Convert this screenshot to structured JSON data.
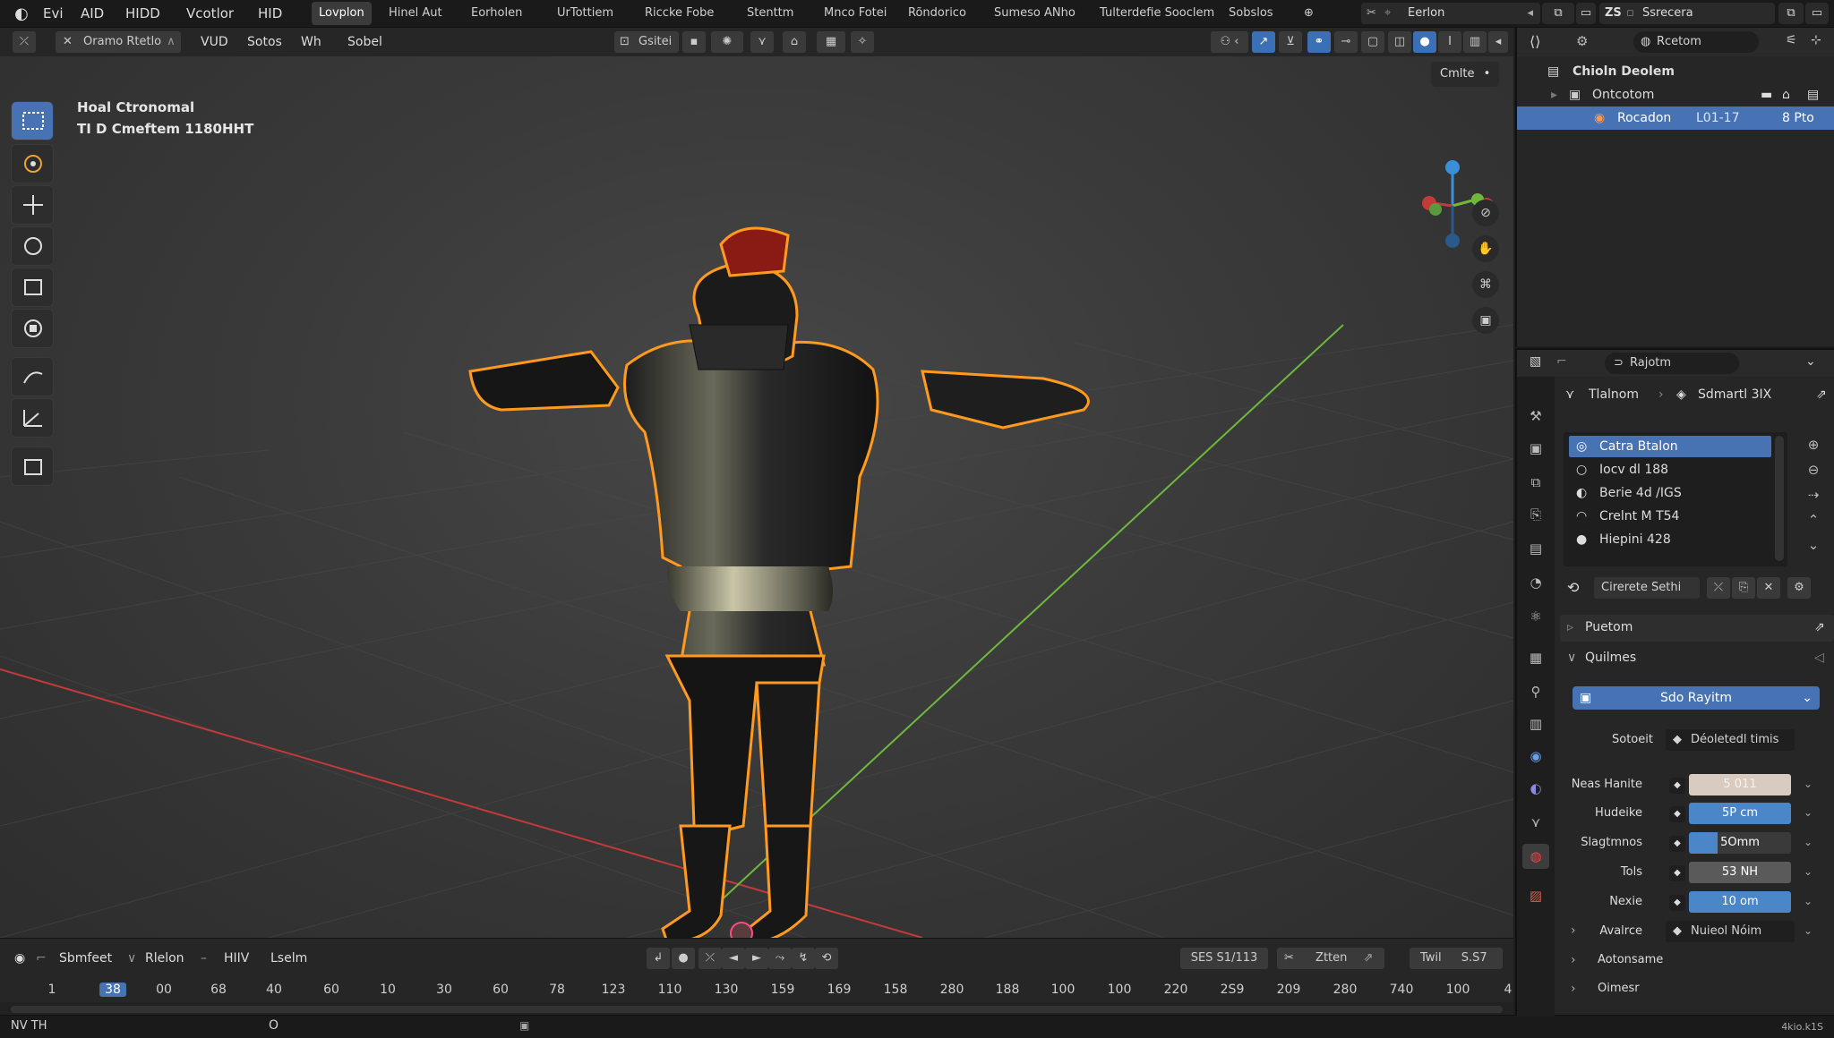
{
  "app_menu": [
    "Evi",
    "AID",
    "HIDD",
    "Vcotlor",
    "HID"
  ],
  "workspace_tabs": [
    "Lovplon",
    "Hinel Aut",
    "Eorholen",
    "UrTottiem",
    "Riccke Fobe",
    "Stenttm",
    "Mnco Fotei",
    "Rõndorico",
    "Sumeso ANho",
    "Tulterdefie Sooclem",
    "Sobslos"
  ],
  "active_workspace": "Lovplon",
  "scene_field": "Eerlon",
  "layer_field": "Ssrecera",
  "layer_code": "ZS",
  "viewport_header": {
    "mode": "Oramo Rtetlo",
    "menus": [
      "VUD",
      "Sotos",
      "Wh",
      "Sobel"
    ],
    "global": "Gsitei"
  },
  "viewport_overlay": {
    "line1": "Hoal Ctronomal",
    "line2": "TI D Cmeftem 1180HHT"
  },
  "gizmo_toggle": "Cmlte",
  "timeline": {
    "playback": "Sbmfeet",
    "keying": "Rlelon",
    "view": "HIIV",
    "marker": "Lselm",
    "frame_range": "SES S1/113",
    "keyframe_label": "Ztten",
    "end_label": "Twil",
    "end_value": "S.S7",
    "ruler": [
      "1",
      "38",
      "00",
      "68",
      "40",
      "60",
      "10",
      "30",
      "60",
      "78",
      "123",
      "110",
      "130",
      "159",
      "169",
      "158",
      "280",
      "188",
      "100",
      "100",
      "220",
      "2S9",
      "209",
      "280",
      "740",
      "100",
      "4"
    ],
    "current_frame": "38"
  },
  "status_bar": {
    "left": "NV TH",
    "middle": "O",
    "right": "4kio.k1S"
  },
  "outliner": {
    "search": "Rcetom",
    "collection": "Chioln Deolem",
    "object": "Ontcotom",
    "selected_name": "Rocadon",
    "selected_info": "L01-17",
    "selected_extra": "8 Pto"
  },
  "properties": {
    "search": "Rajotm",
    "breadcrumb_left": "Tlalnom",
    "breadcrumb_right": "Sdmartl 3IX",
    "materials": [
      "Catra Btalon",
      "Iocv dl 188",
      "Berie 4d /IGS",
      "Crelnt M T54",
      "Hiepini 428"
    ],
    "active_material": "Catra Btalon",
    "material_name": "Cirerete Sethi",
    "panel_preview": "Puetom",
    "panel_outline": "Quilmes",
    "shader_dropdown": "Sdo Rayitm",
    "surface_label": "Sotoeit",
    "surface_value": "Déoletedl timis",
    "rows": [
      {
        "label": "Neas Hanite",
        "value": "5 011",
        "color": "#d9cbbf"
      },
      {
        "label": "Hudeike",
        "value": "5P cm",
        "color": "#4a86c8"
      },
      {
        "label": "Slagtmnos",
        "value": "5Omm",
        "color": "#3a3a3a"
      },
      {
        "label": "Tols",
        "value": "53 NH",
        "color": "#5a5a5a"
      },
      {
        "label": "Nexie",
        "value": "10 om",
        "color": "#4a86c8"
      }
    ],
    "avaire_label": "Avalrce",
    "avaire_value": "Nuieol Nóim",
    "collapsed": [
      "Aotonsame",
      "Oimesr"
    ]
  },
  "colors": {
    "accent": "#4772b3",
    "selection_outline": "#ff9a1f",
    "x_axis": "#c23a3a",
    "y_axis": "#6fb83c",
    "z_axis": "#3a8fd9"
  }
}
